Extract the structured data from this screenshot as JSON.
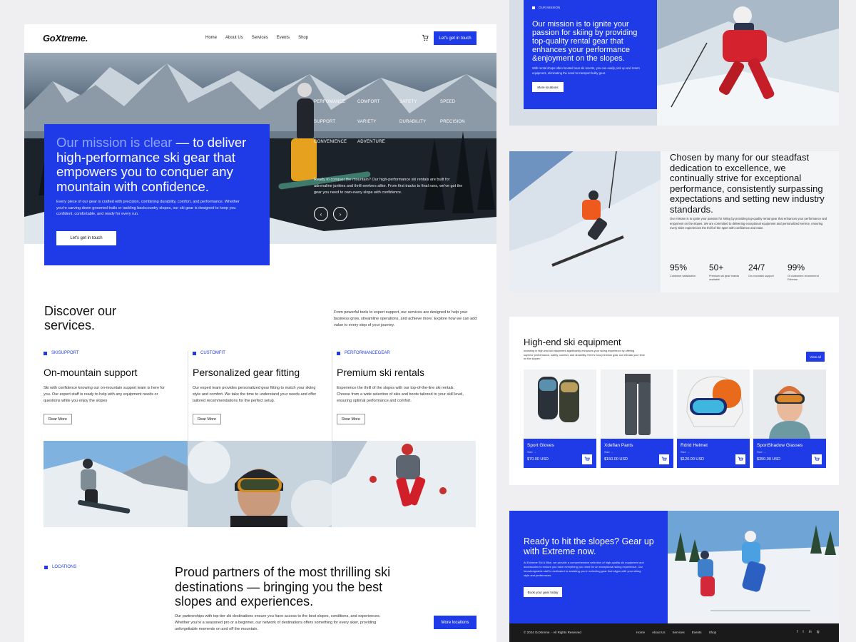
{
  "left": {
    "nav": {
      "logo": "GoXtreme.",
      "menu": [
        "Home",
        "About Us",
        "Services",
        "Events",
        "Shop"
      ],
      "cta": "Let's get in touch"
    },
    "hero": {
      "tags": [
        "PERFOMANCE",
        "COMFORT",
        "SAFETY",
        "SPEED",
        "SUPPORT",
        "VARIETY",
        "DURABILITY",
        "PRECISION",
        "CONVENIENCE",
        "ADVENTURE"
      ],
      "text": "Ready to conquer the mountain? Our high-performance ski rentals are built for adrenaline junkies and thrill-seekers alike. From first tracks to final runs, we've got the gear you need to own every slope with confidence.",
      "prev": "‹",
      "next": "›",
      "mission_highlight": "Our mission is clear",
      "mission_rest": " — to deliver high-performance ski gear that empowers you to conquer any mountain with confidence.",
      "mission_desc": "Every piece of our gear is crafted with precision, combining durability, comfort, and performance. Whether you're carving down groomed trails or tackling backcountry slopes, our ski gear is designed to keep you confident, comfortable, and ready for every run.",
      "mission_btn": "Let's get in touch"
    },
    "discover": {
      "title_1": "Discover our",
      "title_2": "services.",
      "desc": "From powerful tools to expert support, our services are designed to help your business grow, streamline operations, and achieve more. Explore how we can add value to every step of your journey."
    },
    "services": [
      {
        "tag": "SKISUPPORT",
        "title": "On-mountain support",
        "desc": "Ski with confidence knowing our on-mountain support team is here for you. Our expert staff is ready to help with any equipment needs or questions while you enjoy the slopes",
        "btn": "Rear More"
      },
      {
        "tag": "CUSTOMFIT",
        "title": "Personalized gear fitting",
        "desc": "Our expert team provides personalized gear fitting to match your skiing style and comfort. We take the time to understand your needs and offer tailored recommendations for the perfect setup.",
        "btn": "Rear More"
      },
      {
        "tag": "PERFORMANCEGEAR",
        "title": "Premium ski rentals",
        "desc": "Experience the thrill of the slopes with our top-of-the-line ski rentals. Choose from a wide selection of skis and boots tailored to your skill level, ensuring optimal performance and comfort.",
        "btn": "Rear More"
      }
    ],
    "locations": {
      "tag": "LOCATIONS",
      "title": "Proud partners of the most thrilling ski destinations — bringing you the best slopes and experiences.",
      "desc": "Our partnerships with top-tier ski destinations ensure you have access to the best slopes, conditions, and experiences. Whether you're a seasoned pro or a beginner, our network of destinations offers something for every skier, providing unforgettable moments on and off the mountain.",
      "btn": "More locations"
    }
  },
  "right": {
    "mission": {
      "tag": "OUR MISSION",
      "title": "Our mission is to ignite your passion for skiing by providing top-quality rental gear that enhances your performance &enjoyment on the slopes.",
      "desc": "With rental shops often located near ski resorts, you can easily pick up and return equipment, eliminating the need to transport bulky gear.",
      "btn": "More locations"
    },
    "chosen": {
      "title": "Chosen by many for our steadfast dedication to excellence, we continually strive for exceptional performance, consistently surpassing expectations and setting new industry standards.",
      "desc": "Our mission is to ignite your passion for skiing by providing top-quality rental gear that enhances your performance and enjoyment on the slopes. We are committed to delivering exceptional equipment and personalized service, ensuring every skier experiences the thrill of the sport with confidence and ease.",
      "stats": [
        {
          "n": "95%",
          "l": "Customer satisfaction"
        },
        {
          "n": "50+",
          "l": "Premium ski gear brands available"
        },
        {
          "n": "24/7",
          "l": "On-mountain support"
        },
        {
          "n": "99%",
          "l": "Of customers recommend Extreme"
        }
      ]
    },
    "equipment": {
      "title": "High-end ski equipment",
      "desc": "Investing in high-end ski equipment significantly enhances your skiing experience by offering superior performance, safety, comfort, and durability. Here's how premium gear can elevate your time on the slopes:",
      "view_all": "View all",
      "products": [
        {
          "name": "Sport Gloves",
          "size": "Size  →",
          "price": "$70.00 USD"
        },
        {
          "name": "Xdefian Pants",
          "size": "Size  →",
          "price": "$150.00 USD"
        },
        {
          "name": "Rdrid Helmet",
          "size": "Size  →",
          "price": "$120.00 USD"
        },
        {
          "name": "SportShadow Glasses",
          "size": "Size  →",
          "price": "$350.00 USD"
        }
      ]
    },
    "cta": {
      "title": "Ready to hit the slopes? Gear up with Extreme now.",
      "desc": "At Extreme Ski & Bike, we provide a comprehensive selection of high-quality ski equipment and accessories to ensure you have everything you need for an exceptional skiing experience. Our knowledgeable staff is dedicated to assisting you in selecting gear that aligns with your skiing style and preferences.",
      "btn": "Book your gear today"
    },
    "footer": {
      "copy": "© 2024 GoXtreme. - All Rights Reserved",
      "menu": [
        "Home",
        "About Us",
        "Services",
        "Events",
        "Shop"
      ],
      "social": [
        "f",
        "t",
        "in",
        "ig"
      ]
    }
  },
  "colors": {
    "accent": "#1f3be8",
    "footer": "#1a1a1a"
  }
}
